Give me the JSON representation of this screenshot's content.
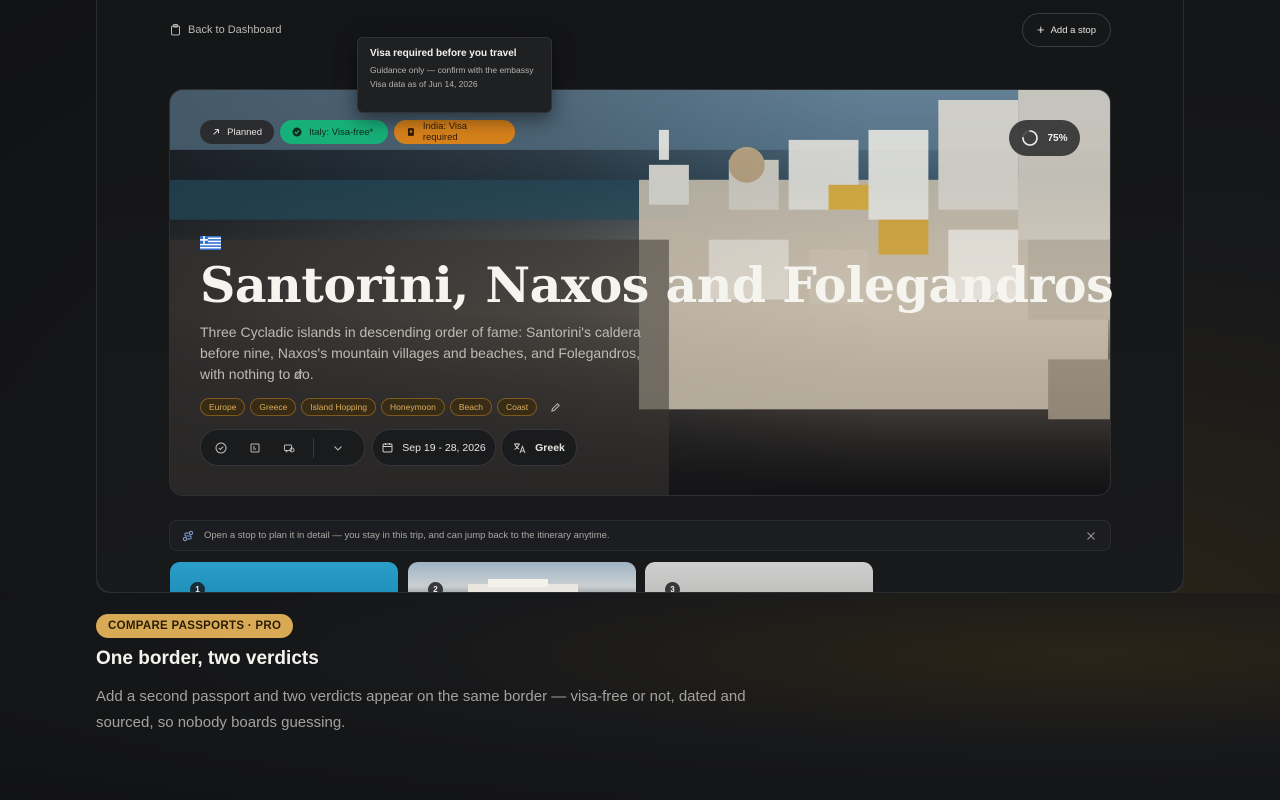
{
  "nav": {
    "back_label": "Back to Dashboard",
    "add_stop_label": "Add a stop"
  },
  "tooltip": {
    "title": "Visa required before you travel",
    "line1": "Guidance only — confirm with the embassy",
    "line2": "Visa data as of Jun 14, 2026"
  },
  "hero": {
    "status_chip": "Planned",
    "visa_chips": [
      {
        "label": "Italy: Visa-free*",
        "color": "#17b07a"
      },
      {
        "label": "India: Visa required",
        "color": "#d7821b"
      }
    ],
    "progress": "75%",
    "progress_fraction": 0.75,
    "title": "Santorini, Naxos and Folegandros",
    "description": "Three Cycladic islands in descending order of fame: Santorini's caldera before nine, Naxos's mountain villages and beaches, and Folegandros, with nothing to do.",
    "tags": [
      "Europe",
      "Greece",
      "Island Hopping",
      "Honeymoon",
      "Beach",
      "Coast"
    ],
    "dates": "Sep 19 - 28, 2026",
    "language": "Greek"
  },
  "hint": {
    "text": "Open a stop to plan it in detail — you stay in this trip, and can jump back to the itinerary anytime."
  },
  "stops": [
    "1",
    "2",
    "3"
  ],
  "promo": {
    "badge": "COMPARE PASSPORTS · PRO",
    "title": "One border, two verdicts",
    "description": "Add a second passport and two verdicts appear on the same border — visa-free or not, dated and sourced, so nobody boards guessing."
  },
  "colors": {
    "accent_gold": "#d9aa55",
    "visa_free": "#17b07a",
    "visa_required": "#d7821b"
  }
}
